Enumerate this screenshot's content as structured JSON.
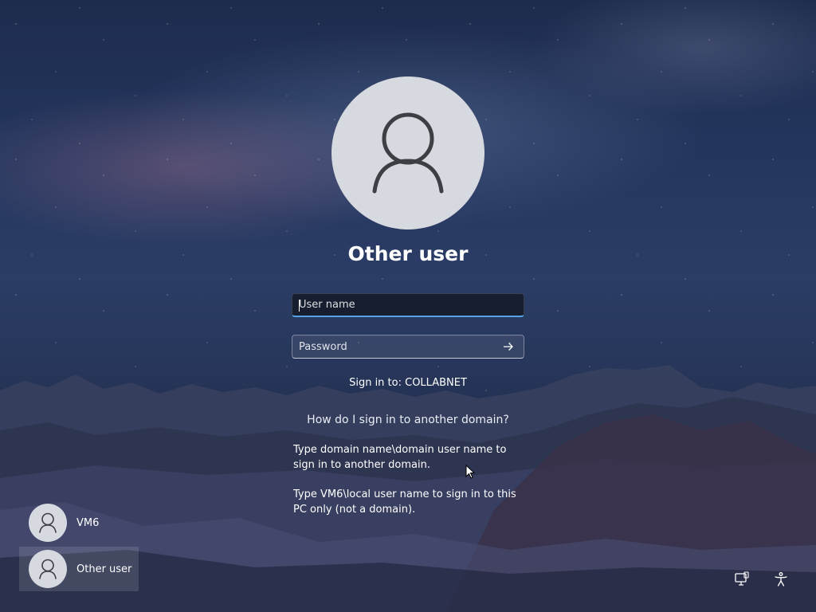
{
  "login": {
    "title": "Other user",
    "username_placeholder": "User name",
    "password_placeholder": "Password",
    "sign_in_to": "Sign in to: COLLABNET",
    "help_link": "How do I sign in to another domain?",
    "help_paragraph_1": "Type domain name\\domain user name to sign in to another domain.",
    "help_paragraph_2": "Type VM6\\local user name to sign in to this PC only (not a domain)."
  },
  "user_list": [
    {
      "name": "VM6",
      "icon": "user-icon"
    },
    {
      "name": "Other user",
      "icon": "user-icon",
      "selected": true
    }
  ],
  "corner_icons": {
    "network": "network-icon",
    "accessibility": "accessibility-icon"
  },
  "colors": {
    "avatar_bg": "#d6dae0",
    "avatar_glyph": "#3c3f44",
    "focus_accent": "#5aa2e8"
  }
}
